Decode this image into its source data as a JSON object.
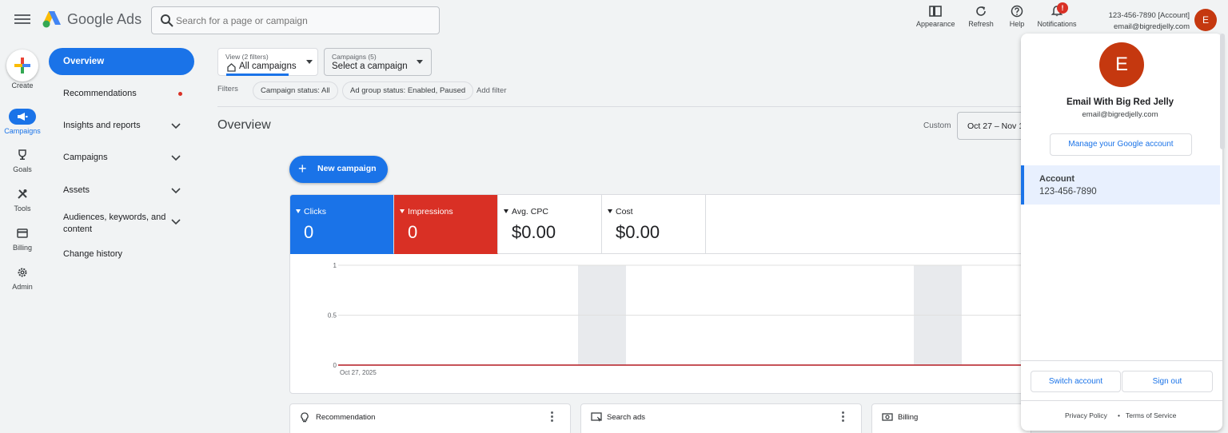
{
  "app": {
    "brand": "Google Ads",
    "search_placeholder": "Search for a page or campaign"
  },
  "toolbar": {
    "appearance": "Appearance",
    "refresh": "Refresh",
    "help": "Help",
    "notifications": "Notifications",
    "notification_badge": "!"
  },
  "account_header": {
    "line1": "123-456-7890 [Account]",
    "line2": "email@bigredjelly.com",
    "avatar_letter": "E"
  },
  "rail": {
    "create": "Create",
    "campaigns": "Campaigns",
    "goals": "Goals",
    "tools": "Tools",
    "billing": "Billing",
    "admin": "Admin"
  },
  "nav": {
    "overview": "Overview",
    "recommendations": "Recommendations",
    "insights": "Insights and reports",
    "campaigns": "Campaigns",
    "assets": "Assets",
    "audiences": "Audiences, keywords, and content",
    "change_history": "Change history"
  },
  "filters": {
    "view_small": "View (2 filters)",
    "view_value": "All campaigns",
    "campaigns_small": "Campaigns (5)",
    "campaigns_value": "Select a campaign",
    "label": "Filters",
    "chips": [
      "Campaign status: All",
      "Ad group status: Enabled, Paused"
    ],
    "add_filter": "Add filter"
  },
  "overview": {
    "title": "Overview",
    "custom_label": "Custom",
    "date_range": "Oct 27 – Nov 1",
    "new_campaign": "New campaign"
  },
  "metrics": [
    {
      "label": "Clicks",
      "value": "0"
    },
    {
      "label": "Impressions",
      "value": "0"
    },
    {
      "label": "Avg. CPC",
      "value": "$0.00"
    },
    {
      "label": "Cost",
      "value": "$0.00"
    }
  ],
  "chart_data": {
    "type": "line",
    "x": [
      "Oct 27, 2025"
    ],
    "series": [
      {
        "values": [
          0,
          0,
          0,
          0,
          0,
          0
        ],
        "color": "#d93025"
      },
      {
        "values": [
          0,
          0,
          0,
          0,
          0,
          0
        ],
        "color": "#1a73e8"
      }
    ],
    "y_ticks": [
      "1",
      "0.5",
      "0"
    ],
    "ylim": [
      0,
      1
    ],
    "x_label": "Oct 27, 2025",
    "grid": true
  },
  "bottom_cards": {
    "recommendation": "Recommendation",
    "search_ads": "Search ads",
    "billing": "Billing"
  },
  "popup": {
    "avatar_letter": "E",
    "name": "Email With Big Red Jelly",
    "email": "email@bigredjelly.com",
    "manage": "Manage your Google account",
    "account_title": "Account",
    "account_number": "123-456-7890",
    "switch": "Switch account",
    "sign_out": "Sign out",
    "privacy": "Privacy Policy",
    "dot": "•",
    "terms": "Terms of Service"
  },
  "colors": {
    "accent": "#1a73e8",
    "impressions": "#d93025",
    "avatar": "#c5380f"
  }
}
